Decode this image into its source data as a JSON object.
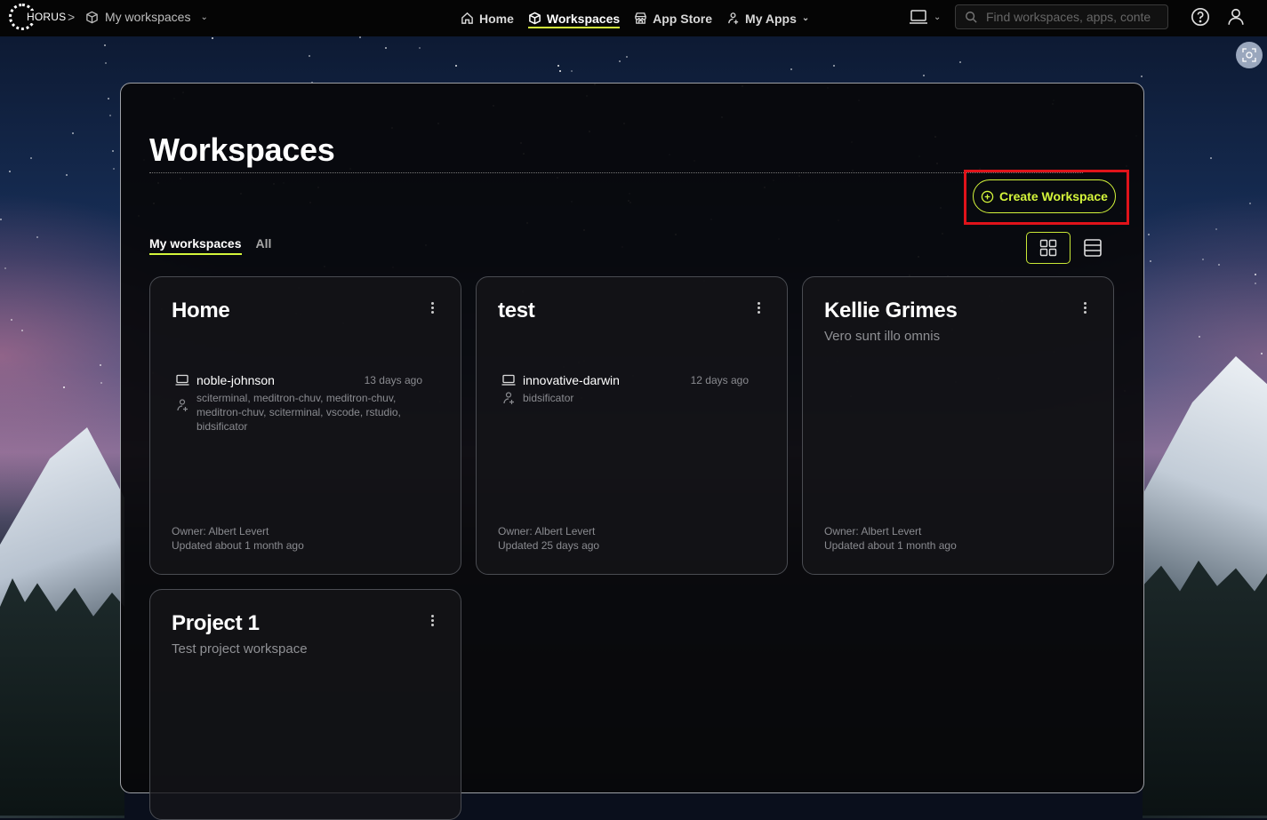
{
  "topbar": {
    "logo_text": "HORUS",
    "breadcrumb": {
      "separator": ">",
      "label": "My workspaces"
    },
    "nav": [
      {
        "label": "Home",
        "icon": "home-icon"
      },
      {
        "label": "Workspaces",
        "icon": "cube-icon",
        "active": true
      },
      {
        "label": "App Store",
        "icon": "store-icon"
      },
      {
        "label": "My Apps",
        "icon": "apps-person-icon"
      }
    ],
    "search_placeholder": "Find workspaces, apps, conte"
  },
  "main": {
    "title": "Workspaces",
    "create_button": "Create Workspace",
    "tabs": [
      {
        "label": "My workspaces",
        "active": true
      },
      {
        "label": "All"
      }
    ]
  },
  "cards": [
    {
      "title": "Home",
      "description": "",
      "session": {
        "name": "noble-johnson",
        "time": "13 days ago",
        "apps": "sciterminal, meditron-chuv, meditron-chuv, meditron-chuv, sciterminal, vscode, rstudio, bidsificator"
      },
      "owner": "Owner: Albert Levert",
      "updated": "Updated about 1 month ago"
    },
    {
      "title": "test",
      "description": "",
      "session": {
        "name": "innovative-darwin",
        "time": "12 days ago",
        "apps": "bidsificator"
      },
      "owner": "Owner: Albert Levert",
      "updated": "Updated 25 days ago"
    },
    {
      "title": "Kellie Grimes",
      "description": "Vero sunt illo omnis",
      "owner": "Owner: Albert Levert",
      "updated": "Updated about 1 month ago"
    },
    {
      "title": "Project 1",
      "description": "Test project workspace"
    }
  ],
  "colors": {
    "accent": "#d4f53b",
    "highlight": "#e0131a",
    "panel_border": "#9ea0a6"
  }
}
